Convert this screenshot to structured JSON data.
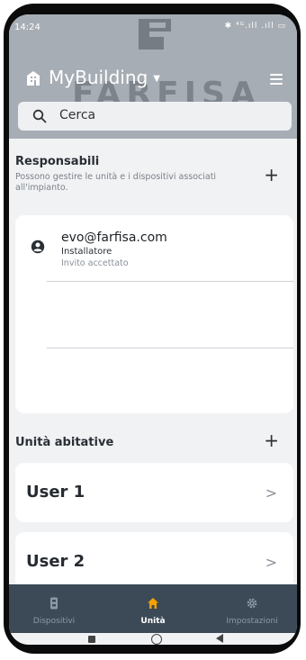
{
  "status_bar": {
    "time": "14:24",
    "icons": "✱ ⁴ᴳ.ıll .ıll ▭"
  },
  "app_bar": {
    "title": "MyBuilding",
    "watermark": "FARFISA"
  },
  "search": {
    "placeholder": "Cerca"
  },
  "responsabili": {
    "title": "Responsabili",
    "description": "Possono gestire le unità e i dispositivi associati all'impianto.",
    "add_label": "+",
    "user": {
      "email": "evo@farfisa.com",
      "role": "Installatore",
      "status": "Invito accettato"
    }
  },
  "unita": {
    "title": "Unità abitative",
    "add_label": "+",
    "items": [
      {
        "label": "User 1",
        "chevron": ">"
      },
      {
        "label": "User 2",
        "chevron": ">"
      }
    ]
  },
  "bottom_nav": {
    "items": [
      {
        "label": "Dispositivi",
        "icon": "device-icon"
      },
      {
        "label": "Unità",
        "icon": "home-icon"
      },
      {
        "label": "Impostazioni",
        "icon": "gear-icon"
      }
    ],
    "active_index": 1
  },
  "colors": {
    "header": "#a7adb4",
    "nav": "#3c4a57",
    "accent": "#f5a000"
  }
}
